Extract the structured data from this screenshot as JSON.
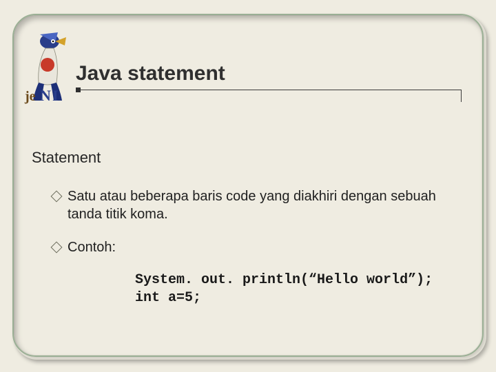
{
  "title": "Java statement",
  "subheading": "Statement",
  "bullets": [
    "Satu atau beberapa baris code yang diakhiri dengan sebuah tanda titik koma.",
    "Contoh:"
  ],
  "code_lines": [
    "System. out. println(“Hello world”);",
    "int a=5;"
  ]
}
